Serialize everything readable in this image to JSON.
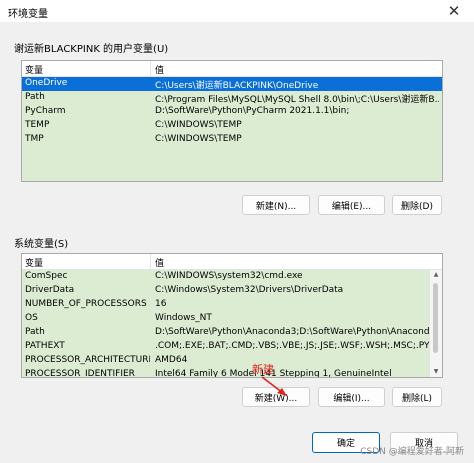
{
  "window": {
    "title": "环境变量",
    "close_glyph": "✕"
  },
  "user_section": {
    "label": "谢运新BLACKPINK 的用户变量(U)",
    "columns": [
      "变量",
      "值"
    ],
    "rows": [
      {
        "name": "OneDrive",
        "value": "C:\\Users\\谢运新BLACKPINK\\OneDrive",
        "selected": true
      },
      {
        "name": "Path",
        "value": "C:\\Program Files\\MySQL\\MySQL Shell 8.0\\bin\\;C:\\Users\\谢运新B..."
      },
      {
        "name": "PyCharm",
        "value": "D:\\SoftWare\\Python\\PyCharm 2021.1.1\\bin;"
      },
      {
        "name": "TEMP",
        "value": "C:\\WINDOWS\\TEMP"
      },
      {
        "name": "TMP",
        "value": "C:\\WINDOWS\\TEMP"
      }
    ],
    "buttons": {
      "new": "新建(N)...",
      "edit": "编辑(E)...",
      "delete": "删除(D)"
    }
  },
  "system_section": {
    "label": "系统变量(S)",
    "columns": [
      "变量",
      "值"
    ],
    "rows": [
      {
        "name": "ComSpec",
        "value": "C:\\WINDOWS\\system32\\cmd.exe"
      },
      {
        "name": "DriverData",
        "value": "C:\\Windows\\System32\\Drivers\\DriverData"
      },
      {
        "name": "NUMBER_OF_PROCESSORS",
        "value": "16"
      },
      {
        "name": "OS",
        "value": "Windows_NT"
      },
      {
        "name": "Path",
        "value": "D:\\SoftWare\\Python\\Anaconda3;D:\\SoftWare\\Python\\Anaconda..."
      },
      {
        "name": "PATHEXT",
        "value": ".COM;.EXE;.BAT;.CMD;.VBS;.VBE;.JS;.JSE;.WSF;.WSH;.MSC;.PY;.PYW"
      },
      {
        "name": "PROCESSOR_ARCHITECTURE",
        "value": "AMD64"
      },
      {
        "name": "PROCESSOR_IDENTIFIER",
        "value": "Intel64 Family 6 Model 141 Stepping 1, GenuineIntel"
      }
    ],
    "buttons": {
      "new": "新建(W)...",
      "edit": "编辑(I)...",
      "delete": "删除(L)"
    }
  },
  "footer": {
    "ok": "确定",
    "cancel": "取消"
  },
  "annotation": {
    "text": "新建",
    "color": "#e0231d"
  },
  "watermark": "CSDN @编程爱好者-阿新",
  "colors": {
    "row_bg": "#dcecd3",
    "selected_bg": "#0a6fd8",
    "primary_border": "#0067c0"
  }
}
